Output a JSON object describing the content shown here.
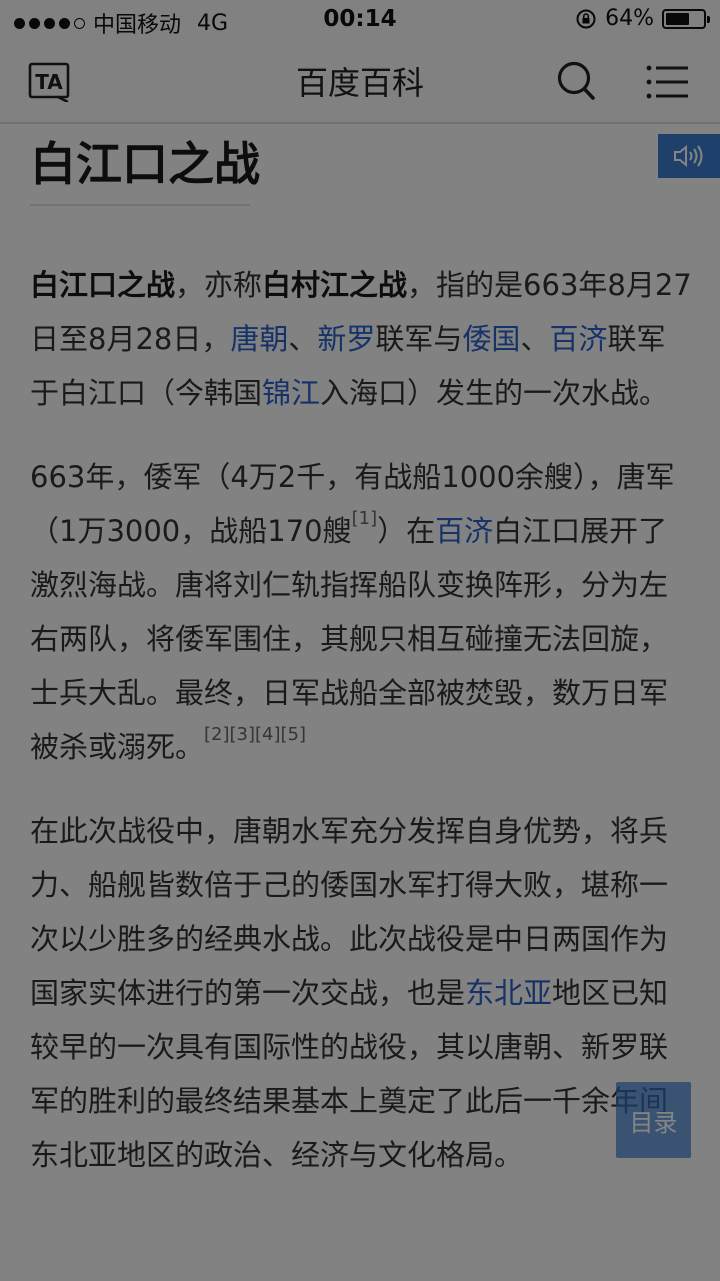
{
  "status_bar": {
    "carrier": "中国移动",
    "network": "4G",
    "time": "00:14",
    "battery": "64%",
    "battery_level": 0.64
  },
  "nav": {
    "title": "百度百科",
    "ta_label": "TA"
  },
  "article": {
    "title": "白江口之战",
    "p1": {
      "t1": "白江口之战",
      "t2": "，亦称",
      "t3": "白村江之战",
      "t4": "，指的是663年8月27日至8月28日，",
      "l1": "唐朝",
      "t5": "、",
      "l2": "新罗",
      "t6": "联军与",
      "l3": "倭国",
      "t7": "、",
      "l4": "百济",
      "t8": "联军于白江口（今韩国",
      "l5": "锦江",
      "t9": "入海口）发生的一次水战。"
    },
    "p2": {
      "t1": "663年，倭军（4万2千，有战船1000余艘），唐军（1万3000，战船170艘",
      "r1": "[1]",
      "t2": "）在",
      "l1": "百济",
      "t3": "白江口展开了激烈海战。唐将刘仁轨指挥船队变换阵形，分为左右两队，将倭军围住，其舰只相互碰撞无法回旋，士兵大乱。最终，日军战船全部被焚毁，数万日军被杀或溺死。",
      "r2": "[2]",
      "r3": "[3]",
      "r4": "[4]",
      "r5": "[5]"
    },
    "p3": {
      "t1": "在此次战役中，唐朝水军充分发挥自身优势，将兵力、船舰皆数倍于己的倭国水军打得大败，堪称一次以少胜多的经典水战。此次战役是中日两国作为国家实体进行的第一次交战，也是",
      "l1": "东北亚",
      "t2": "地区已知较早的一次具有国际性的战役，其以唐朝、新罗联军的胜利的最终结果基本上奠定了此后一千余年间东北亚地区的政治、经济与文化格局。"
    }
  },
  "toc_button": "目录",
  "colors": {
    "link": "#2a62c9",
    "accent": "#3b7ccd",
    "overlay": "rgba(0,0,0,0.48)"
  },
  "icons": [
    "signal-dots-icon",
    "lock-rotation-icon",
    "battery-icon",
    "text-size-icon",
    "search-icon",
    "menu-icon",
    "speaker-icon"
  ]
}
